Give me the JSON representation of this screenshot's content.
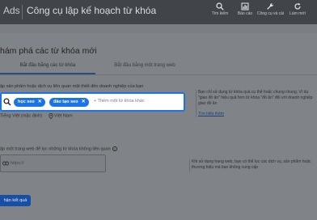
{
  "header": {
    "brand": "Ads",
    "title": "Công cụ lập kế hoạch từ khóa",
    "tools": [
      {
        "label": "Tìm kiếm",
        "icon": "search-icon"
      },
      {
        "label": "Báo cáo",
        "icon": "bar-chart-icon"
      },
      {
        "label": "Công cụ và cài",
        "icon": "wrench-icon"
      },
      {
        "label": "Làm mới",
        "icon": "refresh-icon"
      }
    ]
  },
  "main": {
    "heading": "hám phá các từ khóa mới",
    "tabs": [
      {
        "label": "Bắt đầu bằng các từ khóa",
        "active": true
      },
      {
        "label": "Bắt đầu bằng một trang web",
        "active": false
      }
    ],
    "keywords_section": {
      "description": "ập sản phẩm hoặc dịch vụ liên quan mật thiết đến doanh nghiệp của bạn",
      "chips": [
        "học seo",
        "đào tạo seo"
      ],
      "placeholder": "+ Thêm một từ khóa khác",
      "language": "Tiếng Việt (mặc định)",
      "location": "Việt Nam"
    },
    "help_keywords": {
      "text": "Bạn chỉ sử dụng từ khóa quá cụ thể hoặc chung chung. Ví dụ \"giao đồ ăn\" hiệu quả hơn từ khóa \"đồ ăn\" đối với doanh nghiệp giao đồ ăn",
      "link": "Tìm hiểu thêm"
    },
    "website_section": {
      "description": "ập một trang web để lọc những từ khóa không liên quan",
      "placeholder": "https://"
    },
    "help_website": {
      "text": "Khi sử dụng trang web, bạn có thể lọc các dịch vụ, sản phẩm hoặc thương hiệu mà bạn không cung cấp"
    },
    "result_button": "hận kết quả"
  },
  "colors": {
    "accent": "#1a73e8",
    "topbar": "#414449",
    "primary_button": "#174ea6"
  }
}
